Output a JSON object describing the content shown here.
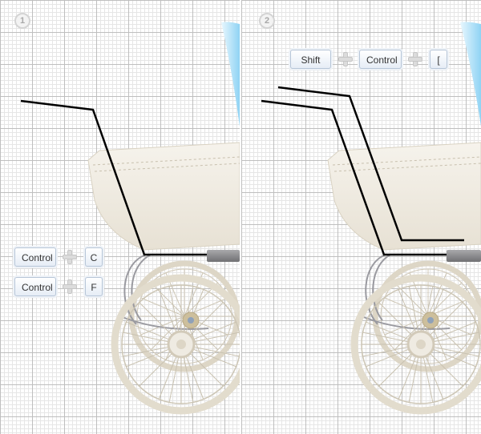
{
  "panels": [
    {
      "step_number": "1",
      "keys": [
        "Control",
        "C",
        "Control",
        "F"
      ]
    },
    {
      "step_number": "2",
      "keys": [
        "Shift",
        "Control",
        "["
      ]
    }
  ],
  "colors": {
    "grid_major": "#bfbfbf",
    "grid_minor": "#e6e6e6",
    "pram_body": "#f1eee6",
    "wheel": "#ded7c8",
    "sky_accent": "#a9dcf5",
    "path_stroke": "#000000"
  }
}
